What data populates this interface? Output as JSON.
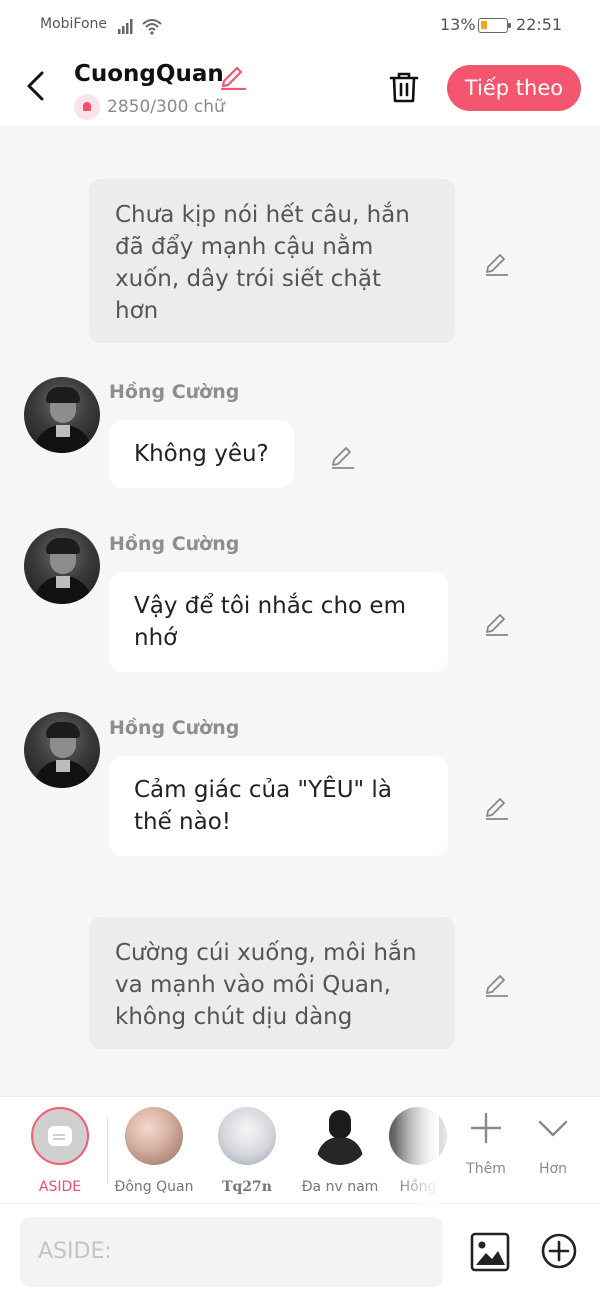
{
  "status_bar": {
    "carrier": "MobiFone",
    "battery": "13%",
    "time": "22:51"
  },
  "header": {
    "title": "CuongQuan",
    "word_count": "2850/300 chữ",
    "next_label": "Tiếp theo",
    "accent": "#f4556f"
  },
  "messages": [
    {
      "type": "aside",
      "text": "Chưa kịp nói hết câu, hắn đã đẩy mạnh cậu nằm xuốn, dây trói siết chặt hơn"
    },
    {
      "type": "char",
      "sender": "Hồng Cường",
      "text": "Không yêu?"
    },
    {
      "type": "char",
      "sender": "Hồng Cường",
      "text": "Vậy để tôi nhắc cho em nhớ"
    },
    {
      "type": "char",
      "sender": "Hồng Cường",
      "text": "Cảm giác của \"YÊU\" là thế nào!"
    },
    {
      "type": "aside",
      "text": "Cường cúi xuống, môi hắn va mạnh vào môi Quan, không chút dịu dàng"
    }
  ],
  "characters": [
    {
      "label": "ASIDE",
      "selected": true
    },
    {
      "label": "Đông Quan"
    },
    {
      "label": "Tq27n"
    },
    {
      "label": "Đa nv nam"
    },
    {
      "label": "Hồng"
    }
  ],
  "tools": {
    "more_label": "Thêm",
    "expand_label": "Hơn"
  },
  "input": {
    "placeholder": "ASIDE:"
  }
}
